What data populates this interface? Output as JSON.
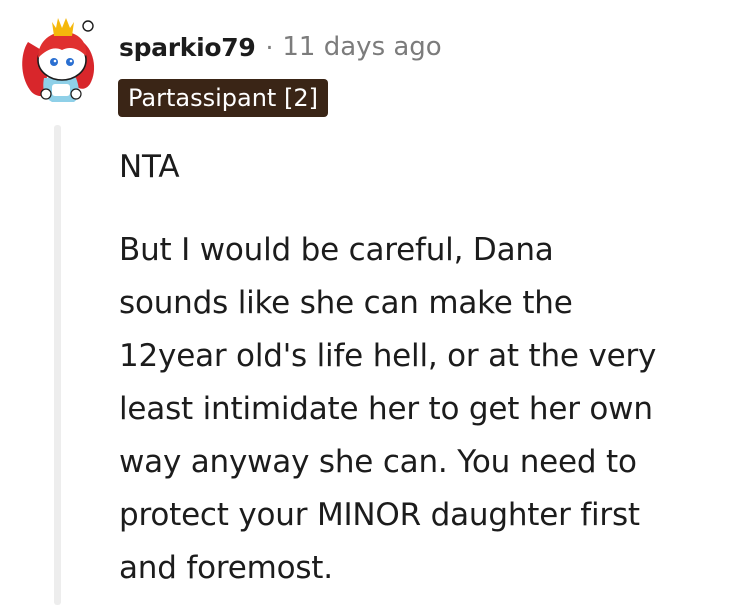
{
  "comment": {
    "username": "sparkio79",
    "separator": "·",
    "timestamp": "11 days ago",
    "flair": "Partassipant [2]",
    "avatar_icon": "snoo-avatar-icon",
    "paragraphs": [
      "NTA",
      "But I would be careful, Dana\nsounds like she can make the\n12year old's life hell, or at the very\nleast intimidate her to get her own\nway anyway she can. You need to\nprotect your MINOR daughter first\nand foremost."
    ]
  },
  "colors": {
    "flair_bg": "#3a2516",
    "text": "#1c1c1c",
    "meta": "#7c7c7c",
    "thread_line": "#ededed"
  }
}
